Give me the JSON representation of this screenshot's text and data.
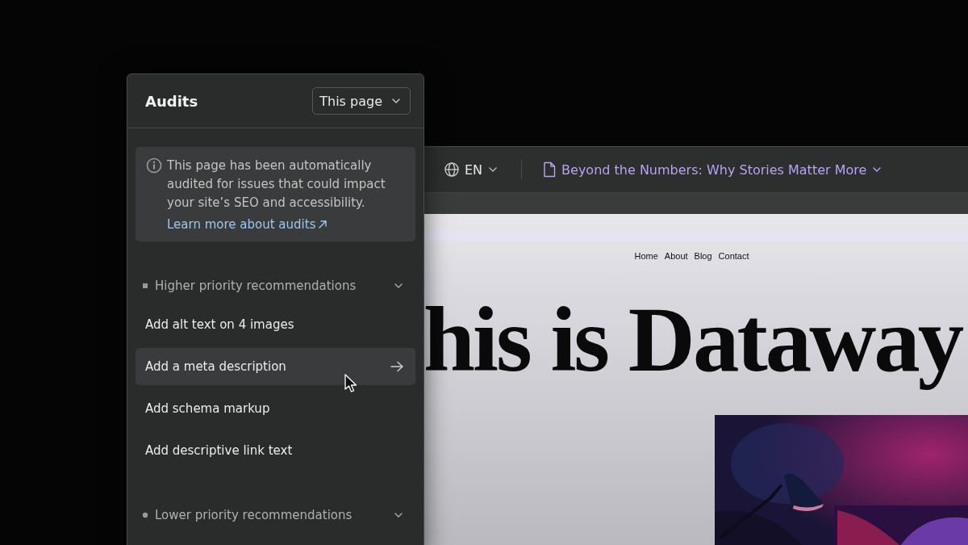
{
  "panel": {
    "title": "Audits",
    "scope_select": {
      "value": "This page"
    },
    "notice": {
      "text": "This page has been automatically audited for issues that could impact your site’s SEO and accessibility.",
      "link": "Learn more about audits"
    },
    "sections": [
      {
        "title": "Higher priority recommendations",
        "kind": "square",
        "expanded": true,
        "items": [
          {
            "label": "Add alt text on 4 images",
            "selected": false
          },
          {
            "label": "Add a meta description",
            "selected": true
          },
          {
            "label": "Add schema markup",
            "selected": false
          },
          {
            "label": "Add descriptive link text",
            "selected": false
          }
        ]
      },
      {
        "title": "Lower priority recommendations",
        "kind": "dot",
        "expanded": true
      }
    ]
  },
  "editor": {
    "locale": "EN",
    "page_title": "Beyond the Numbers: Why Stories Matter More",
    "preview": {
      "nav": [
        "Home",
        "About",
        "Blog",
        "Contact"
      ],
      "headline": "his is Dataway"
    }
  }
}
